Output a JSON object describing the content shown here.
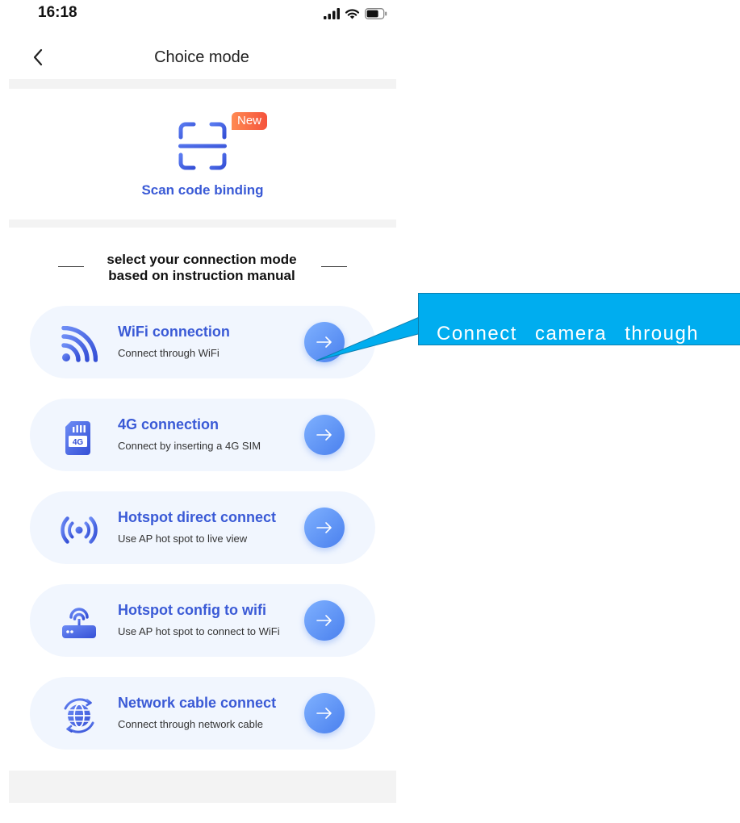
{
  "status_bar": {
    "time": "16:18",
    "icons": [
      "signal-icon",
      "wifi-icon",
      "battery-icon"
    ]
  },
  "nav": {
    "title": "Choice mode",
    "back_icon": "chevron-left-icon"
  },
  "scan": {
    "label": "Scan code binding",
    "badge": "New",
    "icon": "scan-frame-icon"
  },
  "section": {
    "line1": "select your connection mode",
    "line2": "based on instruction manual"
  },
  "options": [
    {
      "title": "WiFi connection",
      "subtitle": "Connect through WiFi",
      "icon": "wifi-signal-icon"
    },
    {
      "title": "4G connection",
      "subtitle": "Connect by inserting a 4G SIM",
      "icon": "sim-card-icon",
      "icon_text": "4G"
    },
    {
      "title": "Hotspot direct connect",
      "subtitle": "Use AP hot spot to live view",
      "icon": "hotspot-icon"
    },
    {
      "title": "Hotspot config to wifi",
      "subtitle": "Use AP hot spot to connect to WiFi",
      "icon": "router-icon"
    },
    {
      "title": "Network cable connect",
      "subtitle": "Connect through network cable",
      "icon": "globe-network-icon"
    }
  ],
  "callout": {
    "text": "Connect camera through"
  },
  "colors": {
    "accent": "#3a5ad6",
    "card_bg": "#f1f6fe",
    "badge": "#f5533c",
    "callout": "#00adef"
  }
}
